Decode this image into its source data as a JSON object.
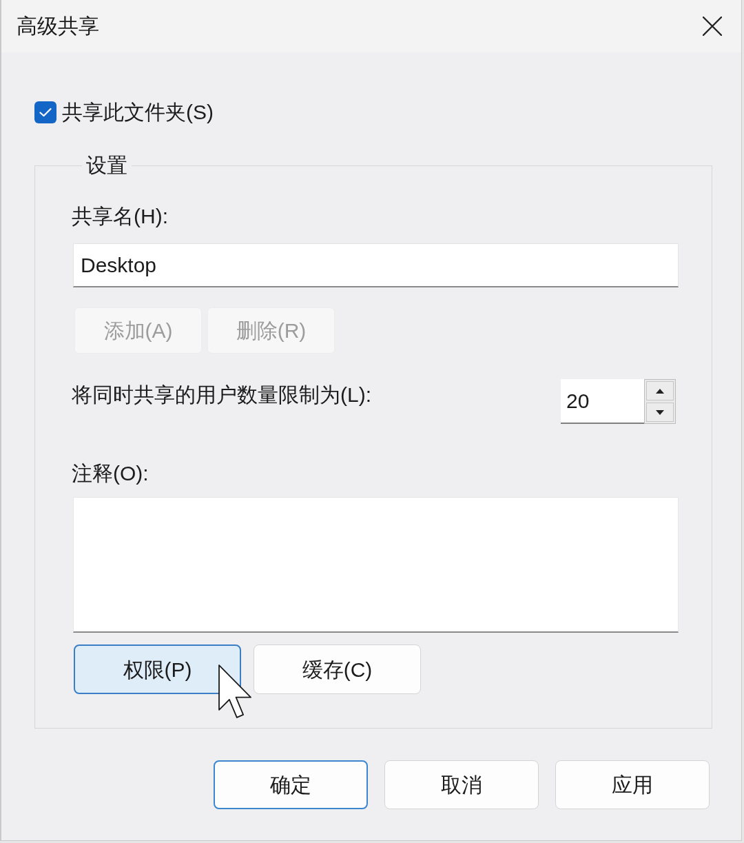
{
  "window": {
    "title": "高级共享"
  },
  "share_checkbox": {
    "label": "共享此文件夹(S)",
    "checked": true
  },
  "settings_group": {
    "title": "设置",
    "share_name": {
      "label": "共享名(H):",
      "value": "Desktop"
    },
    "name_buttons": [
      {
        "label": "添加(A)",
        "disabled": true
      },
      {
        "label": "删除(R)",
        "disabled": true
      }
    ],
    "user_limit": {
      "label": "将同时共享的用户数量限制为(L):",
      "value": "20"
    },
    "comment": {
      "label": "注释(O):"
    },
    "buttons": [
      {
        "label": "权限(P)",
        "hovered": true
      },
      {
        "label": "缓存(C)",
        "hovered": false
      }
    ]
  },
  "dialog_buttons": [
    {
      "label": "确定",
      "default": true
    },
    {
      "label": "取消",
      "default": false
    },
    {
      "label": "应用",
      "default": false
    }
  ]
}
